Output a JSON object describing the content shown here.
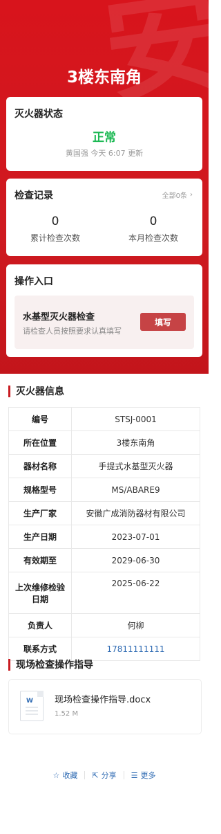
{
  "header": {
    "title": "3楼东南角",
    "watermark": "安"
  },
  "status_card": {
    "title": "灭火器状态",
    "status": "正常",
    "meta": "黄国强 今天 6:07 更新",
    "status_color": "#1db954"
  },
  "records_card": {
    "title": "检查记录",
    "all_link": "全部0条",
    "total_count": "0",
    "total_label": "累计检查次数",
    "month_count": "0",
    "month_label": "本月检查次数"
  },
  "ops_card": {
    "title": "操作入口",
    "item_name": "水基型灭火器检查",
    "item_desc": "请检查人员按照要求认真填写",
    "fill_button": "填写"
  },
  "info_section": {
    "title": "灭火器信息",
    "rows": [
      {
        "label": "编号",
        "value": "STSJ-0001"
      },
      {
        "label": "所在位置",
        "value": "3楼东南角"
      },
      {
        "label": "器材名称",
        "value": "手提式水基型灭火器"
      },
      {
        "label": "规格型号",
        "value": "MS/ABARE9"
      },
      {
        "label": "生产厂家",
        "value": "安徽广成消防器材有限公司"
      },
      {
        "label": "生产日期",
        "value": "2023-07-01"
      },
      {
        "label": "有效期至",
        "value": "2029-06-30"
      },
      {
        "label": "上次维修检验日期",
        "value": "2025-06-22"
      },
      {
        "label": "负责人",
        "value": "何柳"
      },
      {
        "label": "联系方式",
        "value": "17811111111"
      }
    ]
  },
  "guide_section": {
    "title": "现场检查操作指导",
    "file_name": "现场检查操作指导.docx",
    "file_size": "1.52 M",
    "file_icon": "word-doc-icon"
  },
  "footer": {
    "favorite": "收藏",
    "share": "分享",
    "more": "更多"
  },
  "colors": {
    "brand_red": "#d8141c",
    "button_red": "#c64345",
    "link_blue": "#2f6bb3"
  }
}
